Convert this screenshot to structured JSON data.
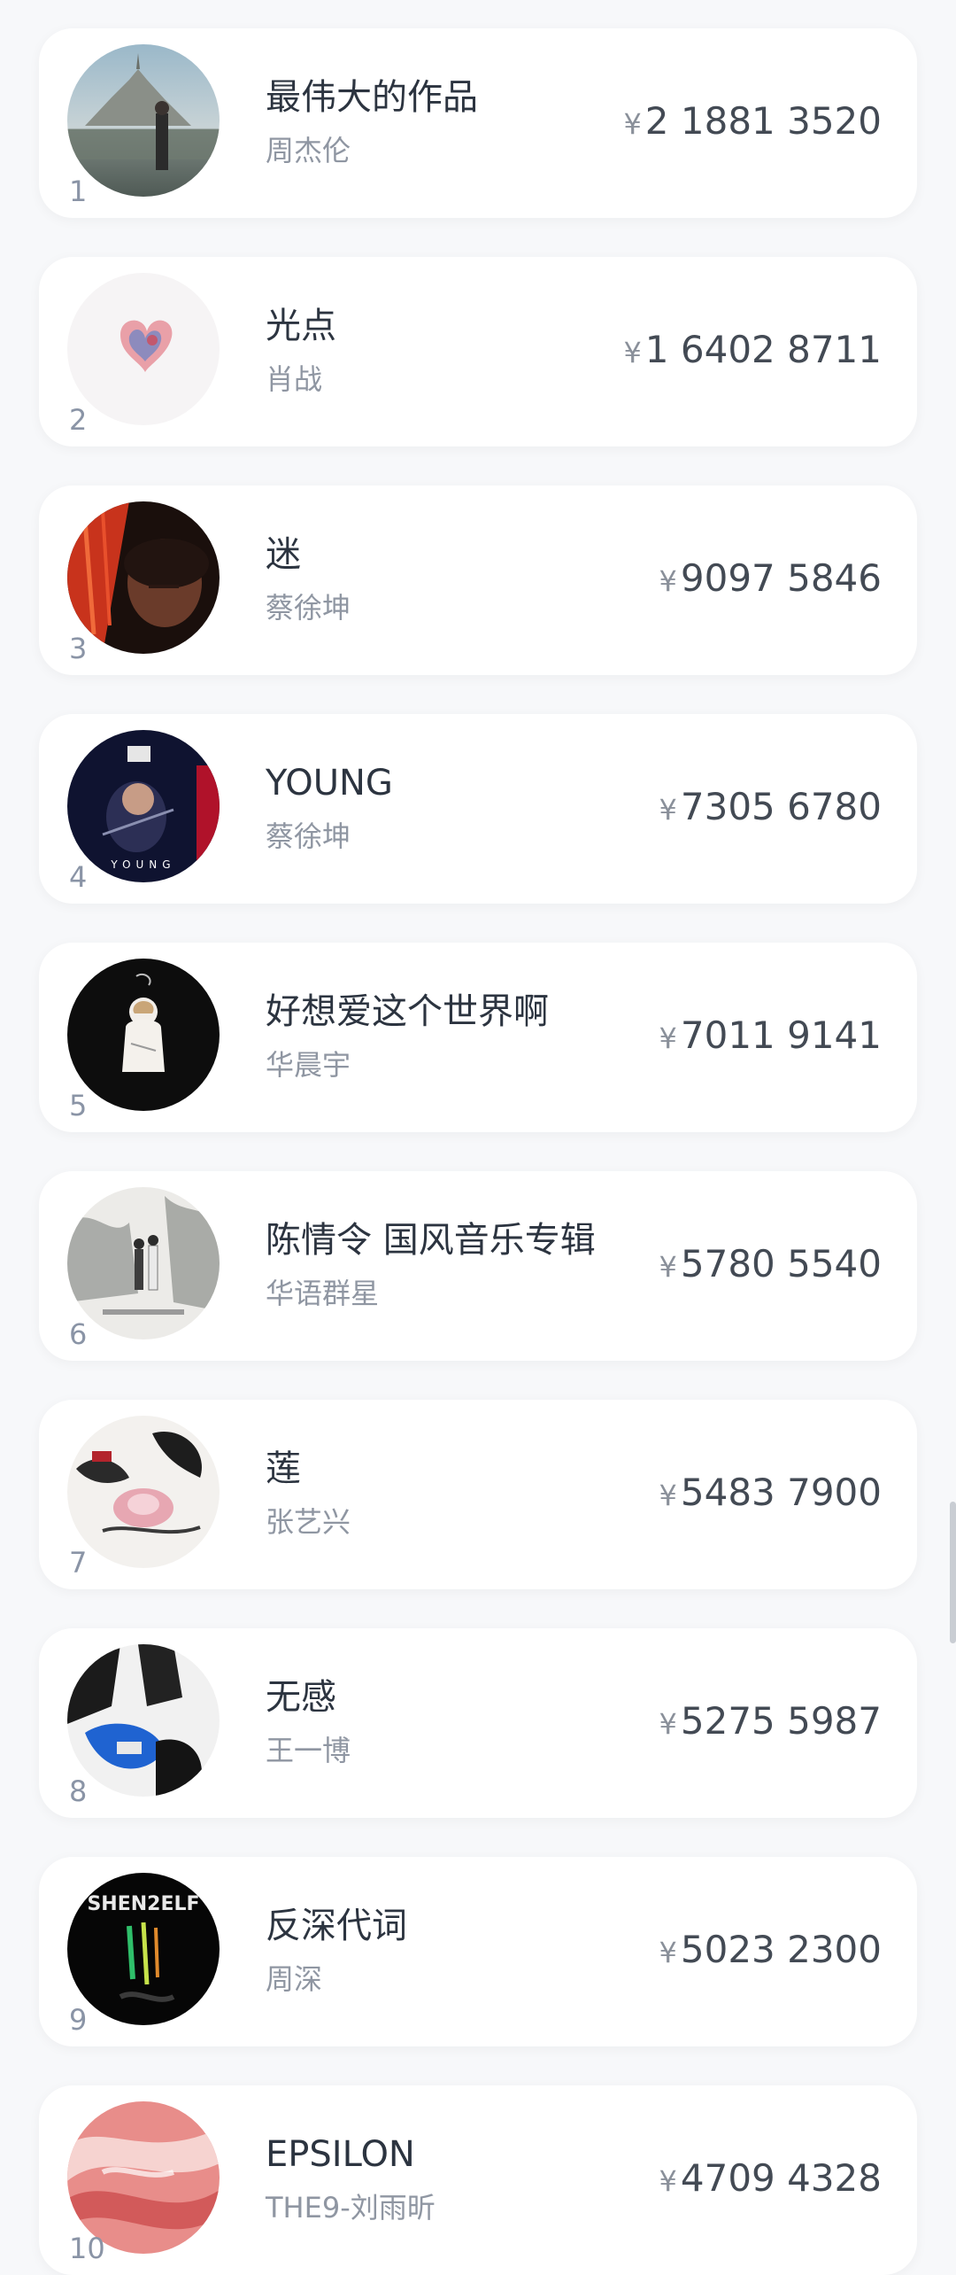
{
  "currency_symbol": "¥",
  "ranking": [
    {
      "rank": "1",
      "title": "最伟大的作品",
      "artist": "周杰伦",
      "amount": "2 1881 3520",
      "cover": "landscape-cover"
    },
    {
      "rank": "2",
      "title": "光点",
      "artist": "肖战",
      "amount": "1 6402 8711",
      "cover": "heart-cover"
    },
    {
      "rank": "3",
      "title": "迷",
      "artist": "蔡徐坤",
      "amount": "9097 5846",
      "cover": "red-portrait-cover"
    },
    {
      "rank": "4",
      "title": "YOUNG",
      "artist": "蔡徐坤",
      "amount": "7305 6780",
      "cover": "stage-cover"
    },
    {
      "rank": "5",
      "title": "好想爱这个世界啊",
      "artist": "华晨宇",
      "amount": "7011 9141",
      "cover": "figure-cover"
    },
    {
      "rank": "6",
      "title": "陈情令 国风音乐专辑",
      "artist": "华语群星",
      "amount": "5780 5540",
      "cover": "ink-painting-cover"
    },
    {
      "rank": "7",
      "title": "莲",
      "artist": "张艺兴",
      "amount": "5483 7900",
      "cover": "lotus-cover"
    },
    {
      "rank": "8",
      "title": "无感",
      "artist": "王一博",
      "amount": "5275 5987",
      "cover": "blue-abstract-cover"
    },
    {
      "rank": "9",
      "title": "反深代词",
      "artist": "周深",
      "amount": "5023 2300",
      "cover": "shenself-cover"
    },
    {
      "rank": "10",
      "title": "EPSILON",
      "artist": "THE9-刘雨昕",
      "amount": "4709 4328",
      "cover": "pink-swirl-cover"
    }
  ],
  "covers": {
    "cover_3_text": "",
    "cover_4_label": "YOUNG",
    "cover_9_label": "SHEN2ELF"
  }
}
